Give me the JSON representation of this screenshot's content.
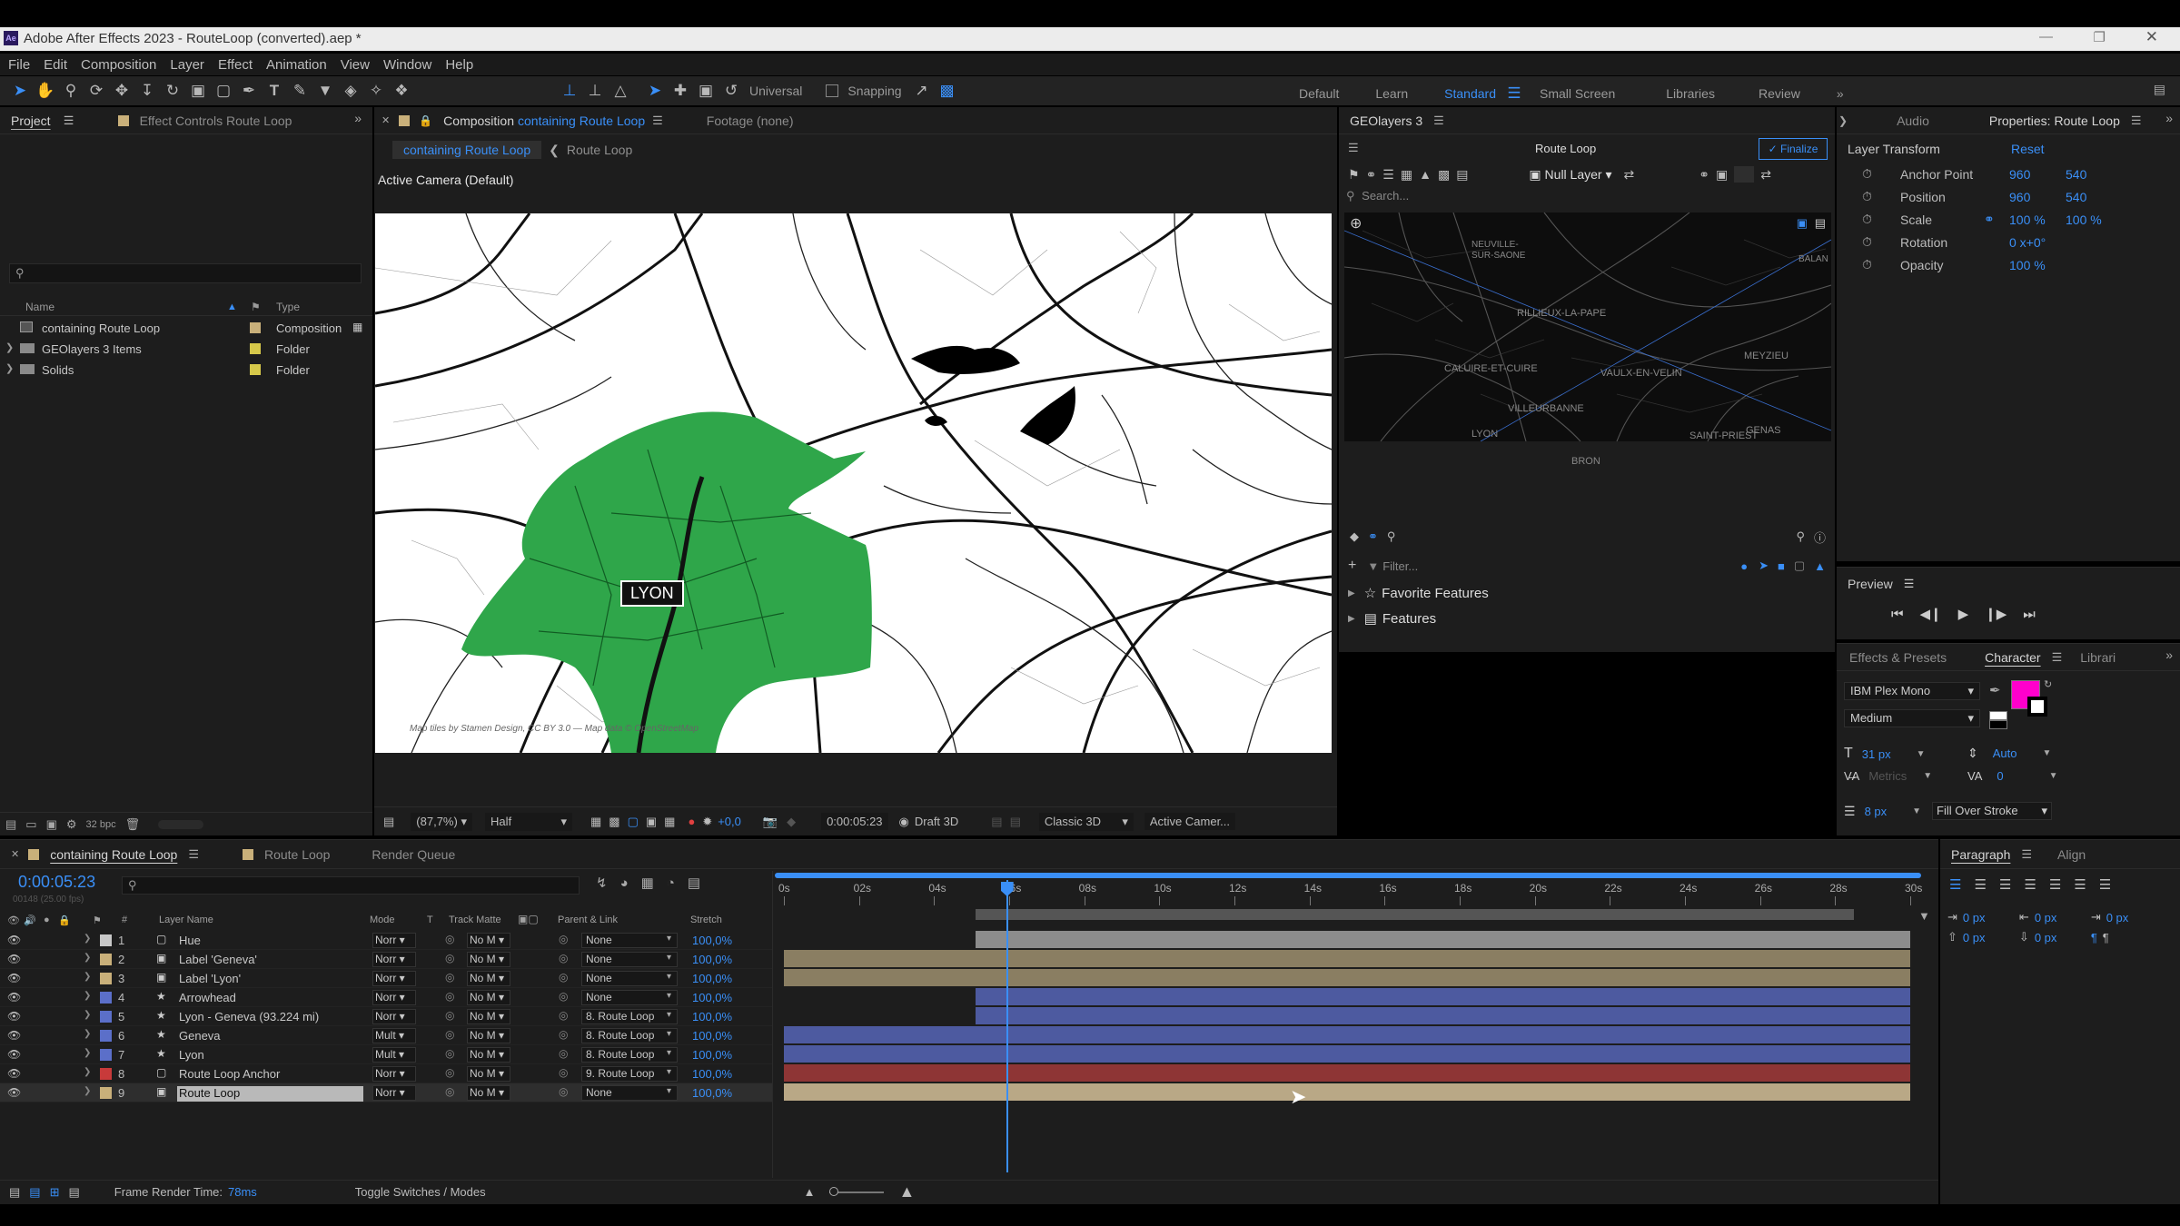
{
  "app": {
    "title": "Adobe After Effects 2023 - RouteLoop (converted).aep *",
    "icon_label": "Ae"
  },
  "menu": [
    "File",
    "Edit",
    "Composition",
    "Layer",
    "Effect",
    "Animation",
    "View",
    "Window",
    "Help"
  ],
  "toolbar": {
    "universal": "Universal",
    "snapping": "Snapping",
    "workspaces": [
      "Default",
      "Learn",
      "Standard",
      "Small Screen",
      "Libraries",
      "Review"
    ],
    "active_workspace": "Standard"
  },
  "project": {
    "tab_project": "Project",
    "tab_effect_controls": "Effect Controls Route Loop",
    "col_name": "Name",
    "col_type": "Type",
    "items": [
      {
        "name": "containing Route Loop",
        "type": "Composition",
        "color": "#c9b07a"
      },
      {
        "name": "GEOlayers 3 Items",
        "type": "Folder",
        "color": "#d6c84a"
      },
      {
        "name": "Solids",
        "type": "Folder",
        "color": "#d6c84a"
      }
    ],
    "bpc": "32 bpc"
  },
  "composition": {
    "tab_prefix": "Composition",
    "tab_name": "containing Route Loop",
    "footage": "Footage (none)",
    "breadcrumb_active": "containing Route Loop",
    "breadcrumb_child": "Route Loop",
    "camera": "Active Camera (Default)",
    "map_label": "LYON",
    "attribution": "Map tiles by Stamen Design, CC BY 3.0 — Map data © OpenStreetMap",
    "footer": {
      "zoom": "(87,7%)",
      "resolution": "Half",
      "exposure": "+0,0",
      "timecode": "0:00:05:23",
      "draft": "Draft 3D",
      "renderer": "Classic 3D",
      "camera": "Active Camer..."
    }
  },
  "geolayers": {
    "tab": "GEOlayers 3",
    "title": "Route Loop",
    "finalize": "Finalize",
    "null_layer": "Null Layer",
    "search_placeholder": "Search...",
    "filter_placeholder": "Filter...",
    "places": [
      "NEUVILLE-SUR-SAONE",
      "RILLIEUX-LA-PAPE",
      "CALUIRE-ET-CUIRE",
      "VAULX-EN-VELIN",
      "MEYZIEU",
      "VILLEURBANNE",
      "LYON",
      "BRON",
      "GENAS",
      "SAINT-PRIEST",
      "BALAN"
    ],
    "favorite_features": "Favorite Features",
    "features": "Features"
  },
  "properties": {
    "tab_audio": "Audio",
    "tab_properties": "Properties: Route Loop",
    "section": "Layer Transform",
    "reset": "Reset",
    "rows": [
      {
        "label": "Anchor Point",
        "v1": "960",
        "v2": "540"
      },
      {
        "label": "Position",
        "v1": "960",
        "v2": "540"
      },
      {
        "label": "Scale",
        "v1": "100 %",
        "v2": "100 %"
      },
      {
        "label": "Rotation",
        "v1": "0 x+0°",
        "v2": ""
      },
      {
        "label": "Opacity",
        "v1": "100 %",
        "v2": ""
      }
    ]
  },
  "preview": {
    "title": "Preview"
  },
  "character": {
    "tab_effects": "Effects & Presets",
    "tab_character": "Character",
    "tab_libraries": "Librari",
    "font": "IBM Plex Mono",
    "weight": "Medium",
    "size": "31 px",
    "leading": "Auto",
    "kerning": "Metrics",
    "tracking": "0",
    "stroke_width": "8 px",
    "stroke_mode": "Fill Over Stroke",
    "fill_color": "#ff00cc"
  },
  "paragraph": {
    "tab_paragraph": "Paragraph",
    "tab_align": "Align",
    "indent_values": [
      "0 px",
      "0 px",
      "0 px",
      "0 px",
      "0 px"
    ]
  },
  "timeline": {
    "tabs": [
      "containing Route Loop",
      "Route Loop",
      "Render Queue"
    ],
    "timecode": "0:00:05:23",
    "frame_info": "00148 (25.00 fps)",
    "columns": {
      "num": "#",
      "layer_name": "Layer Name",
      "mode": "Mode",
      "t": "T",
      "track_matte": "Track Matte",
      "parent": "Parent & Link",
      "stretch": "Stretch"
    },
    "ruler": [
      "0s",
      "02s",
      "04s",
      "06s",
      "08s",
      "10s",
      "12s",
      "14s",
      "16s",
      "18s",
      "20s",
      "22s",
      "24s",
      "26s",
      "28s",
      "30s"
    ],
    "layers": [
      {
        "num": "1",
        "name": "Hue",
        "icon": "solid",
        "label_color": "#c8c8c8",
        "mode": "Norr",
        "matte": "No M",
        "parent": "None",
        "stretch": "100,0%",
        "bar_color": "#8c8c8c",
        "bar_start_s": 5.1,
        "bar_end_s": 30
      },
      {
        "num": "2",
        "name": "Label 'Geneva'",
        "icon": "comp",
        "label_color": "#c9b07a",
        "mode": "Norr",
        "matte": "No M",
        "parent": "None",
        "stretch": "100,0%",
        "bar_color": "#8a7e62",
        "bar_start_s": 0,
        "bar_end_s": 30
      },
      {
        "num": "3",
        "name": "Label 'Lyon'",
        "icon": "comp",
        "label_color": "#c9b07a",
        "mode": "Norr",
        "matte": "No M",
        "parent": "None",
        "stretch": "100,0%",
        "bar_color": "#8a7e62",
        "bar_start_s": 0,
        "bar_end_s": 30
      },
      {
        "num": "4",
        "name": "Arrowhead",
        "icon": "star",
        "label_color": "#5b6fc9",
        "mode": "Norr",
        "matte": "No M",
        "parent": "None",
        "stretch": "100,0%",
        "bar_color": "#4d5aa0",
        "bar_start_s": 5.1,
        "bar_end_s": 30
      },
      {
        "num": "5",
        "name": "Lyon - Geneva (93.224 mi)",
        "icon": "star",
        "label_color": "#5b6fc9",
        "mode": "Norr",
        "matte": "No M",
        "parent": "8. Route Loop",
        "stretch": "100,0%",
        "bar_color": "#4d5aa0",
        "bar_start_s": 5.1,
        "bar_end_s": 30
      },
      {
        "num": "6",
        "name": "Geneva",
        "icon": "star",
        "label_color": "#5b6fc9",
        "mode": "Mult",
        "matte": "No M",
        "parent": "8. Route Loop",
        "stretch": "100,0%",
        "bar_color": "#4d5aa0",
        "bar_start_s": 0,
        "bar_end_s": 30
      },
      {
        "num": "7",
        "name": "Lyon",
        "icon": "star",
        "label_color": "#5b6fc9",
        "mode": "Mult",
        "matte": "No M",
        "parent": "8. Route Loop",
        "stretch": "100,0%",
        "bar_color": "#4d5aa0",
        "bar_start_s": 0,
        "bar_end_s": 30
      },
      {
        "num": "8",
        "name": "Route Loop Anchor",
        "icon": "solid",
        "label_color": "#c83a3a",
        "mode": "Norr",
        "matte": "No M",
        "parent": "9. Route Loop",
        "stretch": "100,0%",
        "bar_color": "#8e3535",
        "bar_start_s": 0,
        "bar_end_s": 30
      },
      {
        "num": "9",
        "name": "Route Loop",
        "icon": "comp",
        "label_color": "#c9b07a",
        "mode": "Norr",
        "matte": "No M",
        "parent": "None",
        "stretch": "100,0%",
        "bar_color": "#b9a886",
        "bar_start_s": 0,
        "bar_end_s": 30
      }
    ],
    "playhead_s": 5.92,
    "work_area_s": [
      5.1,
      28.5
    ],
    "footer_render": "Frame Render Time:",
    "footer_render_value": "78ms",
    "toggle": "Toggle Switches / Modes"
  }
}
